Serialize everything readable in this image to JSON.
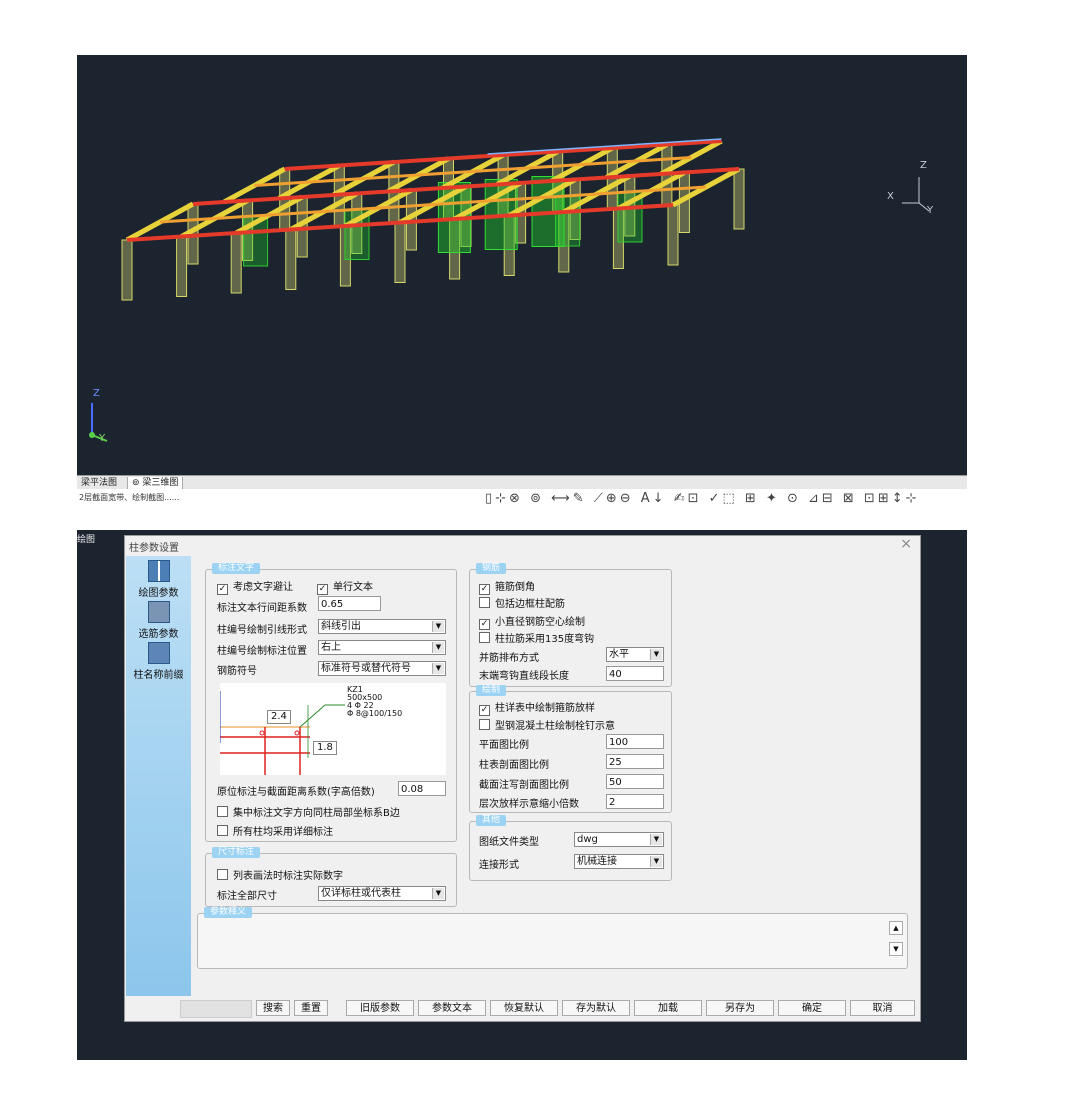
{
  "cad": {
    "tabs": [
      "梁平法图",
      "梁三维图"
    ],
    "command_text": "2层截面宽带、绘制截图......",
    "axis_top": {
      "z": "Z",
      "x": "X",
      "y": "Y"
    },
    "axis_bottom": {
      "z": "Z",
      "y": "Y"
    },
    "toolbar_icons": "▯⊹⊗ ⊚ ⟷✎ ⟋⊕⊖ A↓ ✍⊡ ✓⬚ ⊞ ✦ ⊙ ⊿⊟ ⊠ ⊡⊞↕⊹"
  },
  "app": {
    "left_label": "绘图"
  },
  "dialog": {
    "title": "柱参数设置",
    "close_label": "×",
    "side_items": [
      "绘图参数",
      "选筋参数",
      "柱名称前缀"
    ],
    "annot": {
      "title": "标注文字",
      "avoid_text": {
        "label": "考虑文字避让",
        "checked": true
      },
      "single_line": {
        "label": "单行文本",
        "checked": true
      },
      "line_spacing_label": "标注文本行间距系数",
      "line_spacing_value": "0.65",
      "leader_label": "柱编号绘制引线形式",
      "leader_value": "斜线引出",
      "position_label": "柱编号绘制标注位置",
      "position_value": "右上",
      "rebar_symbol_label": "钢筋符号",
      "rebar_symbol_value": "标准符号或替代符号",
      "preview": {
        "kz": "KZ1",
        "size": "500x500",
        "main": "4 Φ 22",
        "stirrup": "Φ 8@100/150",
        "v1": "2.4",
        "v2": "1.8"
      },
      "distance_label": "原位标注与截面距离系数(字高倍数)",
      "distance_value": "0.08",
      "local_axis": {
        "label": "集中标注文字方向同柱局部坐标系B边",
        "checked": false
      },
      "detail_all": {
        "label": "所有柱均采用详细标注",
        "checked": false
      }
    },
    "dim": {
      "title": "尺寸标注",
      "actual_num": {
        "label": "列表画法时标注实际数字",
        "checked": false
      },
      "all_dims_label": "标注全部尺寸",
      "all_dims_value": "仅详标柱或代表柱"
    },
    "rebar": {
      "title": "钢筋",
      "stirrup_chamfer": {
        "label": "箍筋倒角",
        "checked": true
      },
      "edge_frame": {
        "label": "包括边框柱配筋",
        "checked": false
      },
      "small_hollow": {
        "label": "小直径钢筋空心绘制",
        "checked": true
      },
      "hook135": {
        "label": "柱拉筋采用135度弯钩",
        "checked": false
      },
      "bundle_label": "并筋排布方式",
      "bundle_value": "水平",
      "hook_len_label": "末端弯钩直线段长度",
      "hook_len_value": "40"
    },
    "draw": {
      "title": "绘制",
      "detail_sample": {
        "label": "柱详表中绘制箍筋放样",
        "checked": true
      },
      "steel_concrete": {
        "label": "型钢混凝土柱绘制栓钉示意",
        "checked": false
      },
      "plan_scale_label": "平面图比例",
      "plan_scale_value": "100",
      "table_scale_label": "柱表剖面图比例",
      "table_scale_value": "25",
      "section_scale_label": "截面注写剖面图比例",
      "section_scale_value": "50",
      "shrink_label": "层次放样示意缩小倍数",
      "shrink_value": "2"
    },
    "other": {
      "title": "其他",
      "file_type_label": "图纸文件类型",
      "file_type_value": "dwg",
      "connect_label": "连接形式",
      "connect_value": "机械连接"
    },
    "meaning": {
      "title": "参数释义"
    },
    "buttons": [
      "搜索",
      "重置",
      "旧版参数",
      "参数文本",
      "恢复默认",
      "存为默认",
      "加载",
      "另存为",
      "确定",
      "取消"
    ]
  }
}
